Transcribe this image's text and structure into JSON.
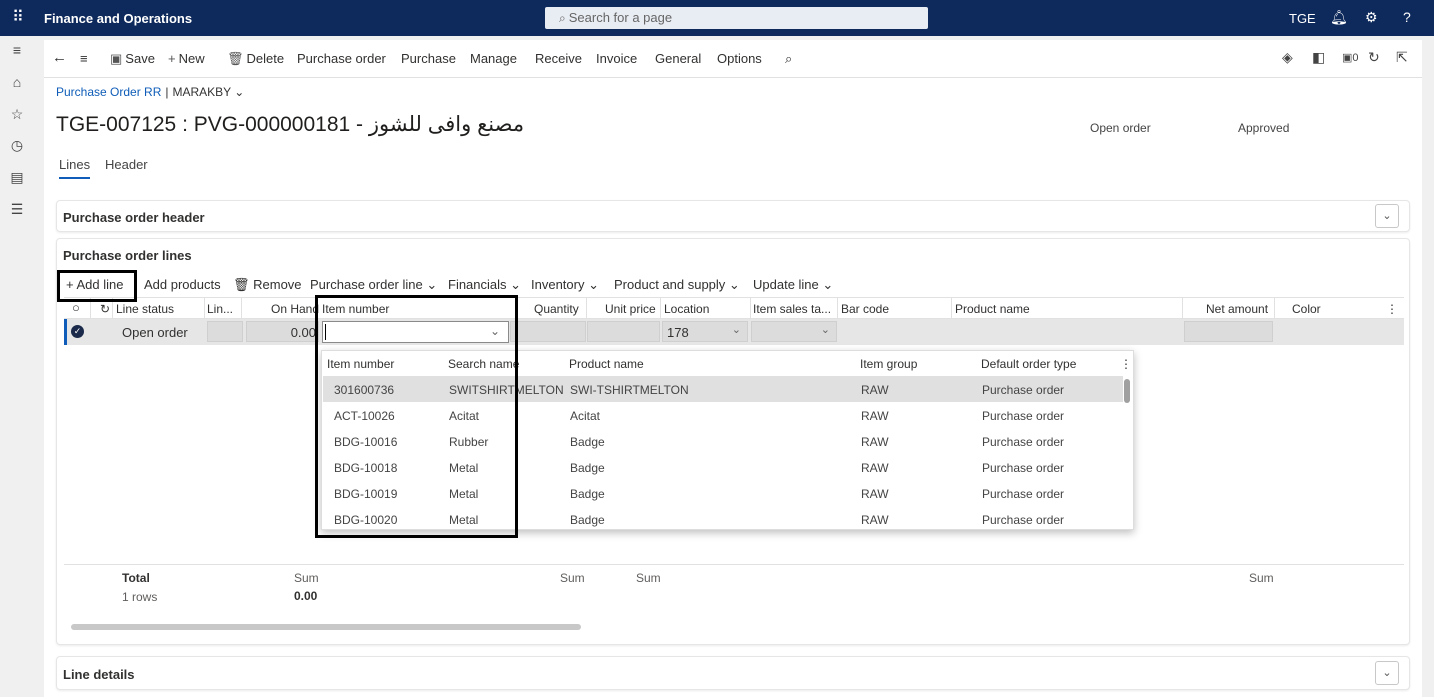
{
  "topbar": {
    "app_name": "Finance and Operations",
    "search_placeholder": "Search for a page",
    "company": "TGE"
  },
  "actionbar": {
    "save": "Save",
    "new": "New",
    "delete": "Delete",
    "menus": [
      "Purchase order",
      "Purchase",
      "Manage",
      "Receive",
      "Invoice",
      "General",
      "Options"
    ],
    "badge_count": "0"
  },
  "breadcrumb": {
    "link": "Purchase Order RR",
    "separator": "|",
    "company_filter": "MARAKBY"
  },
  "page": {
    "title": "TGE-007125 : PVG-000000181 - مصنع وافى للشوز",
    "status_open": "Open order",
    "status_approval": "Approved",
    "tabs": [
      "Lines",
      "Header"
    ]
  },
  "header_section": {
    "title": "Purchase order header"
  },
  "lines_section": {
    "title": "Purchase order lines",
    "toolbar": {
      "add_line": "Add line",
      "add_products": "Add products",
      "remove": "Remove",
      "menus": [
        "Purchase order line",
        "Financials",
        "Inventory",
        "Product and supply",
        "Update line"
      ]
    },
    "columns": [
      "Line status",
      "Lin...",
      "On Hand",
      "Item number",
      "Quantity",
      "Unit price",
      "Location",
      "Item sales ta...",
      "Bar code",
      "Product name",
      "Net amount",
      "Color"
    ],
    "row": {
      "line_status": "Open order",
      "on_hand": "0.00",
      "location": "178"
    },
    "totals": {
      "label": "Total",
      "rows": "1 rows",
      "sum_label": "Sum",
      "on_hand_sum": "0.00"
    }
  },
  "item_lookup": {
    "columns": [
      "Item number",
      "Search name",
      "Product name",
      "Item group",
      "Default order type"
    ],
    "rows": [
      {
        "item": "301600736",
        "search": "SWITSHIRTMELTON",
        "product": "SWI-TSHIRTMELTON",
        "group": "RAW",
        "type": "Purchase order"
      },
      {
        "item": "ACT-10026",
        "search": "Acitat",
        "product": "Acitat",
        "group": "RAW",
        "type": "Purchase order"
      },
      {
        "item": "BDG-10016",
        "search": "Rubber",
        "product": "Badge",
        "group": "RAW",
        "type": "Purchase order"
      },
      {
        "item": "BDG-10018",
        "search": "Metal",
        "product": "Badge",
        "group": "RAW",
        "type": "Purchase order"
      },
      {
        "item": "BDG-10019",
        "search": "Metal",
        "product": "Badge",
        "group": "RAW",
        "type": "Purchase order"
      },
      {
        "item": "BDG-10020",
        "search": "Metal",
        "product": "Badge",
        "group": "RAW",
        "type": "Purchase order"
      }
    ]
  },
  "line_details": {
    "title": "Line details"
  },
  "colors": {
    "topbar": "#0e2a5c",
    "link": "#0f5db8",
    "highlight": "#000000"
  }
}
